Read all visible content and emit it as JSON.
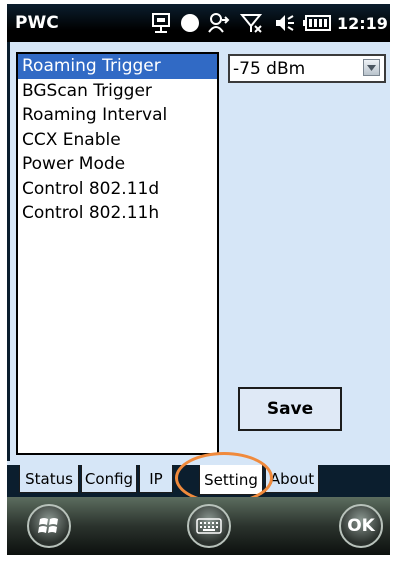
{
  "status_bar": {
    "app_title": "PWC",
    "time": "12:19",
    "icons": [
      "sync-icon",
      "circle-icon",
      "contact-icon",
      "no-signal-icon",
      "volume-icon",
      "battery-icon"
    ]
  },
  "settings_list": {
    "items": [
      {
        "label": "Roaming Trigger",
        "selected": true
      },
      {
        "label": "BGScan Trigger",
        "selected": false
      },
      {
        "label": "Roaming Interval",
        "selected": false
      },
      {
        "label": "CCX Enable",
        "selected": false
      },
      {
        "label": "Power Mode",
        "selected": false
      },
      {
        "label": "Control 802.11d",
        "selected": false
      },
      {
        "label": "Control 802.11h",
        "selected": false
      }
    ]
  },
  "value_select": {
    "selected": "-75 dBm"
  },
  "save_label": "Save",
  "tabs": [
    {
      "label": "Status",
      "active": false
    },
    {
      "label": "Config",
      "active": false
    },
    {
      "label": "IP",
      "active": false
    },
    {
      "label": "Setting",
      "active": true
    },
    {
      "label": "About",
      "active": false
    }
  ],
  "softkeys": {
    "ok_label": "OK"
  },
  "colors": {
    "selection": "#316ac5",
    "background": "#d6e6f7",
    "annotation": "#f08a3c"
  }
}
